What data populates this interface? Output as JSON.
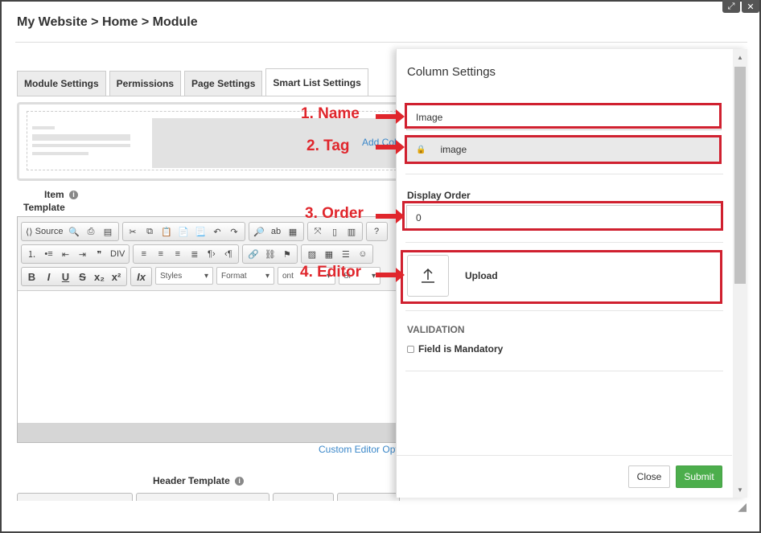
{
  "window": {
    "expand_icon": "expand-icon",
    "close_glyph": "✕"
  },
  "breadcrumb": "My Website > Home > Module",
  "tabs": [
    {
      "label": "Module Settings"
    },
    {
      "label": "Permissions"
    },
    {
      "label": "Page Settings"
    },
    {
      "label": "Smart List Settings"
    }
  ],
  "layout_preview": {
    "add_column": "Add Col"
  },
  "item_template": {
    "label_line1": "Item",
    "label_line2": "Template"
  },
  "editor": {
    "source_label": "Source",
    "styles_label": "Styles",
    "format_label": "Format",
    "font_label": "ont",
    "size_label": "Si"
  },
  "custom_editor_options": "Custom Editor Opt",
  "header_template": {
    "label": "Header Template"
  },
  "annotations": [
    "1. Name",
    "2. Tag",
    "3. Order",
    "4. Editor"
  ],
  "panel": {
    "title": "Column Settings",
    "name_value": "Image",
    "tag_value": "image",
    "display_order_label": "Display Order",
    "display_order_value": "0",
    "upload_label": "Upload",
    "validation_label": "VALIDATION",
    "mandatory_label": "Field is Mandatory",
    "close_label": "Close",
    "submit_label": "Submit"
  },
  "colors": {
    "annotation": "#e0262c",
    "submit": "#4cae4c",
    "link": "#3a87c9"
  }
}
